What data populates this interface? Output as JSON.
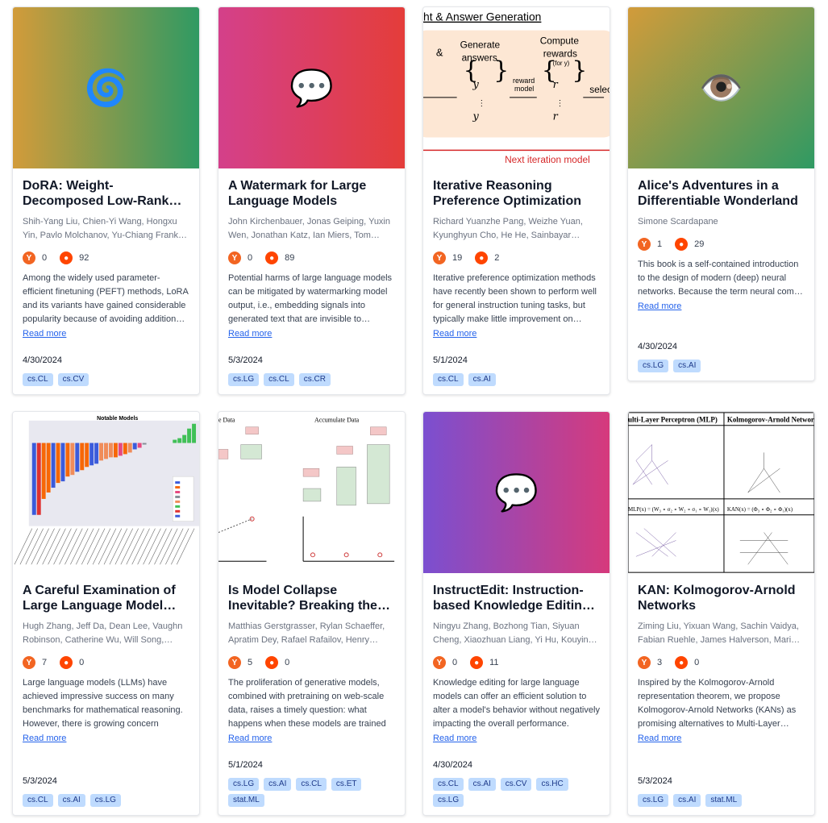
{
  "cards": [
    {
      "title": "DoRA: Weight-Decomposed Low-Rank Adaptation",
      "authors": "Shih-Yang Liu, Chien-Yi Wang, Hongxu Yin, Pavlo Molchanov, Yu-Chiang Frank Wang",
      "yc": "0",
      "reddit": "92",
      "abstract": "Among the widely used parameter-efficient finetuning (PEFT) methods, LoRA and its variants have gained considerable popularity because of avoiding additional inference costs.",
      "read_more": "Read more",
      "date": "4/30/2024",
      "tags": [
        "cs.CL",
        "cs.CV"
      ],
      "thumb_icon": "🌀"
    },
    {
      "title": "A Watermark for Large Language Models",
      "authors": "John Kirchenbauer, Jonas Geiping, Yuxin Wen, Jonathan Katz, Ian Miers, Tom Goldstein",
      "yc": "0",
      "reddit": "89",
      "abstract": "Potential harms of large language models can be mitigated by watermarking model output, i.e., embedding signals into generated text that are invisible to humans.",
      "read_more": "Read more",
      "date": "5/3/2024",
      "tags": [
        "cs.LG",
        "cs.CL",
        "cs.CR"
      ],
      "thumb_icon": "💬"
    },
    {
      "title": "Iterative Reasoning Preference Optimization",
      "authors": "Richard Yuanzhe Pang, Weizhe Yuan, Kyunghyun Cho, He He, Sainbayar Sukhbaatar, Jason Weston",
      "yc": "19",
      "reddit": "2",
      "abstract": "Iterative preference optimization methods have recently been shown to perform well for general instruction tuning tasks, but typically make little improvement on reasoning tasks.",
      "read_more": "Read more",
      "date": "5/1/2024",
      "tags": [
        "cs.CL",
        "cs.AI"
      ],
      "figure": {
        "heading": "ht & Answer Generation",
        "amp": "&",
        "gen": "Generate answers",
        "compute": "Compute rewards",
        "for_y": "(for y)",
        "reward_model": "reward model",
        "select": "selec",
        "next": "Next iteration model"
      }
    },
    {
      "title": "Alice's Adventures in a Differentiable Wonderland",
      "authors": "Simone Scardapane",
      "yc": "1",
      "reddit": "29",
      "abstract": "This book is a self-contained introduction to the design of modern (deep) neural networks. Because the term neural comes with a lot of",
      "read_more": "Read more",
      "date": "4/30/2024",
      "tags": [
        "cs.LG",
        "cs.AI"
      ],
      "thumb_icon": "👁️"
    },
    {
      "title": "A Careful Examination of Large Language Model Performance on Grade School Arithmetic",
      "authors": "Hugh Zhang, Jeff Da, Dean Lee, Vaughn Robinson, Catherine Wu, Will Song, Tiffany Zhao",
      "yc": "7",
      "reddit": "0",
      "abstract": "Large language models (LLMs) have achieved impressive success on many benchmarks for mathematical reasoning. However, there is growing concern",
      "read_more": "Read more",
      "date": "5/3/2024",
      "tags": [
        "cs.CL",
        "cs.AI",
        "cs.LG"
      ],
      "figure": {
        "title": "Notable Models"
      }
    },
    {
      "title": "Is Model Collapse Inevitable? Breaking the Curse of Recursion",
      "authors": "Matthias Gerstgrasser, Rylan Schaeffer, Apratim Dey, Rafael Rafailov, Henry Sleight",
      "yc": "5",
      "reddit": "0",
      "abstract": "The proliferation of generative models, combined with pretraining on web-scale data, raises a timely question: what happens when these models are trained",
      "read_more": "Read more",
      "date": "5/1/2024",
      "tags": [
        "cs.LG",
        "cs.AI",
        "cs.CL",
        "cs.ET",
        "stat.ML"
      ],
      "figure": {
        "left_title": "e Data",
        "right_title": "Accumulate Data"
      }
    },
    {
      "title": "InstructEdit: Instruction-based Knowledge Editing for Large Language Models",
      "authors": "Ningyu Zhang, Bozhong Tian, Siyuan Cheng, Xiaozhuan Liang, Yi Hu, Kouying Xue",
      "yc": "0",
      "reddit": "11",
      "abstract": "Knowledge editing for large language models can offer an efficient solution to alter a model's behavior without negatively impacting the overall performance.",
      "read_more": "Read more",
      "date": "4/30/2024",
      "tags": [
        "cs.CL",
        "cs.AI",
        "cs.CV",
        "cs.HC",
        "cs.LG"
      ],
      "thumb_icon": "💬"
    },
    {
      "title": "KAN: Kolmogorov-Arnold Networks",
      "authors": "Ziming Liu, Yixuan Wang, Sachin Vaidya, Fabian Ruehle, James Halverson, Marin Soljačić",
      "yc": "3",
      "reddit": "0",
      "abstract": "Inspired by the Kolmogorov-Arnold representation theorem, we propose Kolmogorov-Arnold Networks (KANs) as promising alternatives to Multi-Layer Perceptrons",
      "read_more": "Read more",
      "date": "5/3/2024",
      "tags": [
        "cs.LG",
        "cs.AI",
        "stat.ML"
      ],
      "figure": {
        "left": "ulti-Layer Perceptron (MLP)",
        "right": "Kolmogorov-Arnold Network"
      }
    }
  ]
}
